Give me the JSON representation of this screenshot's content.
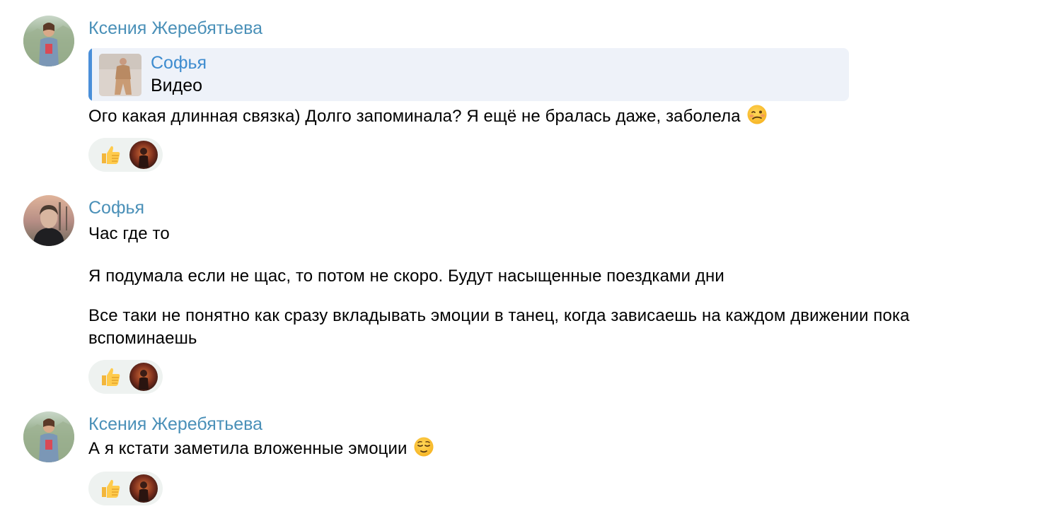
{
  "colors": {
    "author_name": "#4a90b8",
    "reply_author": "#3e8ccf",
    "reply_bar": "#4a8fd9",
    "reply_bg": "#eef2f9",
    "reaction_bg": "#eef2f0"
  },
  "messages": [
    {
      "author": "Ксения Жеребятьева",
      "avatar": "avatar-photo-kseniya",
      "reply": {
        "author": "Софья",
        "text": "Видео",
        "thumb": "video-thumbnail"
      },
      "paragraphs": [
        "Ого какая длинная связка) Долго запоминала? Я ещё не бралась даже, заболела"
      ],
      "trailing_emoji": "woozy-face-emoji",
      "reaction": {
        "emoji": "thumbs-up-emoji",
        "reactor": "reactor-avatar"
      }
    },
    {
      "author": "Софья",
      "avatar": "avatar-photo-sofya",
      "paragraphs": [
        "Час где то",
        "Я подумала если не щас, то потом не скоро. Будут насыщенные поездками дни",
        "Все таки не понятно как сразу вкладывать эмоции в танец, когда зависаешь на каждом движении пока вспоминаешь"
      ],
      "reaction": {
        "emoji": "thumbs-up-emoji",
        "reactor": "reactor-avatar"
      }
    },
    {
      "author": "Ксения Жеребятьева",
      "avatar": "avatar-photo-kseniya",
      "paragraphs": [
        "А я кстати заметила вложенные эмоции"
      ],
      "trailing_emoji": "relieved-face-emoji",
      "reaction": {
        "emoji": "thumbs-up-emoji",
        "reactor": "reactor-avatar"
      }
    }
  ]
}
